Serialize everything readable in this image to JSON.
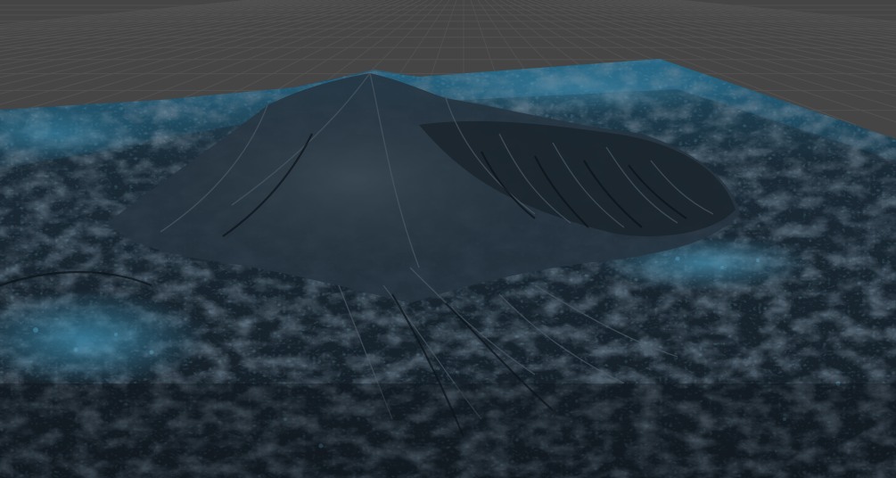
{
  "viewport": {
    "background_color": "#454545",
    "grid_color": "#5a5a5a",
    "grid_visible": true
  },
  "terrain": {
    "base_color": "#1c2a35",
    "ridge_color": "#3a4752",
    "shadow_color": "#0e161d",
    "lowland_tint": "#2a6f8f",
    "highlight_tint": "#4a90b0"
  }
}
